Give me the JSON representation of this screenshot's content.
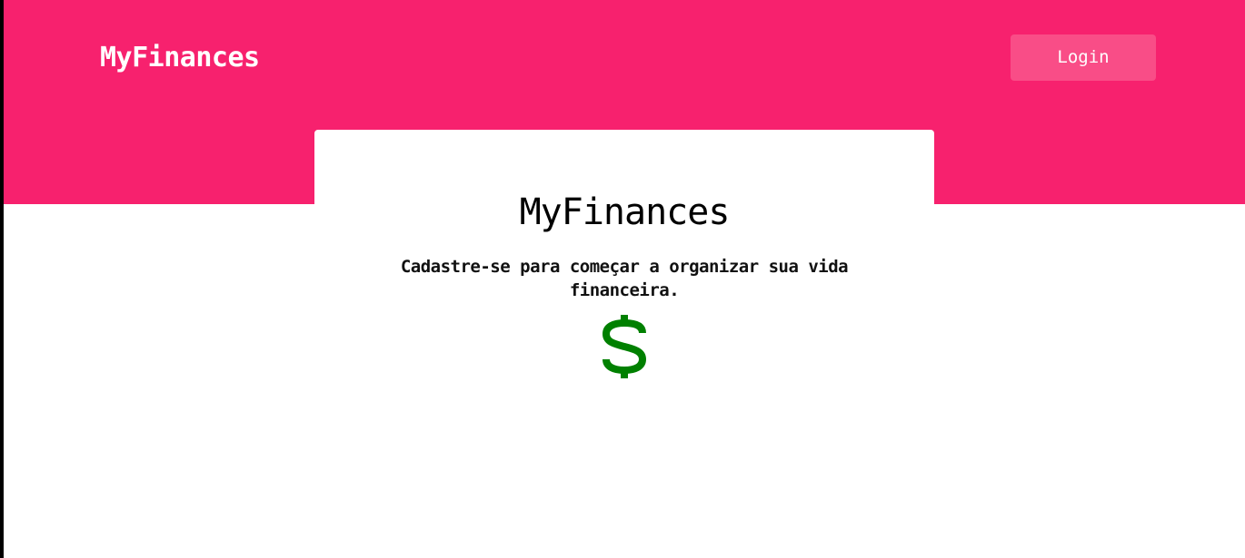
{
  "header": {
    "brand": "MyFinances",
    "login_label": "Login"
  },
  "hero": {
    "title": "MyFinances",
    "subtitle": "Cadastre-se para começar a organizar sua vida financeira.",
    "icon": "dollar-icon"
  },
  "colors": {
    "brand_pink": "#f7216e",
    "button_pink": "#f94d87",
    "dollar_green": "#008000"
  }
}
